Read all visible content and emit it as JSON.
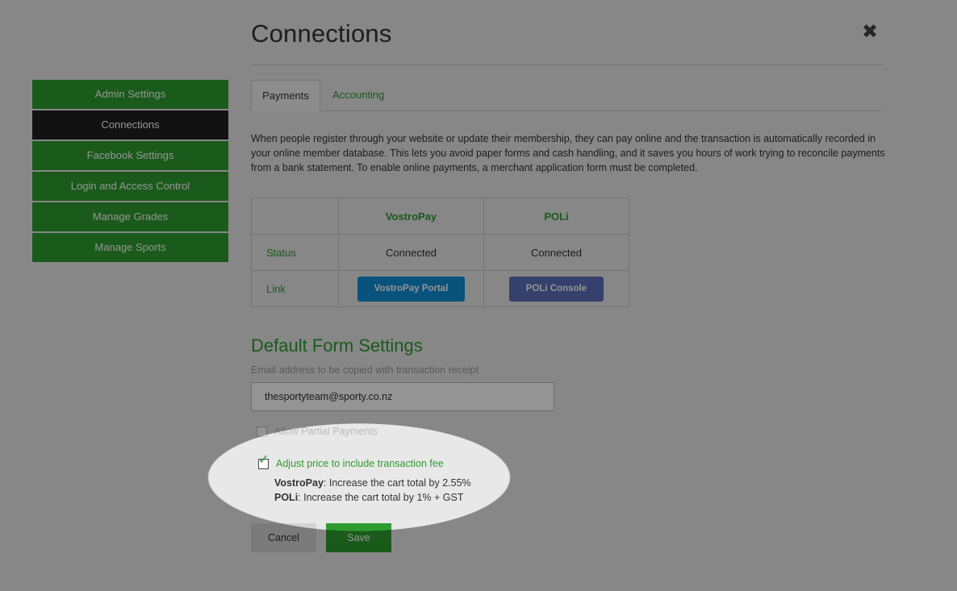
{
  "sidebar": {
    "items": [
      {
        "label": "Admin Settings",
        "active": false
      },
      {
        "label": "Connections",
        "active": true
      },
      {
        "label": "Facebook Settings",
        "active": false
      },
      {
        "label": "Login and Access Control",
        "active": false
      },
      {
        "label": "Manage Grades",
        "active": false
      },
      {
        "label": "Manage Sports",
        "active": false
      }
    ]
  },
  "header": {
    "title": "Connections",
    "close_icon": "✖"
  },
  "tabs": [
    {
      "label": "Payments",
      "active": true
    },
    {
      "label": "Accounting",
      "active": false
    }
  ],
  "intro": "When people register through your website or update their membership, they can pay online and the transaction is automatically recorded in your online member database. This lets you avoid paper forms and cash handling, and it saves you hours of work trying to reconcile payments from a bank statement. To enable online payments, a merchant application form must be completed.",
  "providers_table": {
    "headers": [
      "",
      "VostroPay",
      "POLi"
    ],
    "status_label": "Status",
    "status_values": [
      "Connected",
      "Connected"
    ],
    "link_label": "Link",
    "link_buttons": [
      "VostroPay Portal",
      "POLi Console"
    ]
  },
  "form": {
    "section_title": "Default Form Settings",
    "email_label": "Email address to be copied with transaction receipt",
    "email_value": "thesportyteam@sporty.co.nz",
    "allow_partial_label": "Allow Partial Payments",
    "allow_partial_checked": false,
    "adjust_fee_label": "Adjust price to include transaction fee",
    "adjust_fee_checked": true,
    "fee_lines": [
      {
        "name": "VostroPay",
        "text": ": Increase the cart total by 2.55%"
      },
      {
        "name": "POLi",
        "text": ": Increase the cart total by 1% + GST"
      }
    ],
    "cancel_label": "Cancel",
    "save_label": "Save"
  },
  "colors": {
    "accent_green": "#2e9b30",
    "sidebar_active": "#1f1f1f",
    "vostropay_button": "#0d8fd6",
    "poli_button": "#5c6fba"
  }
}
